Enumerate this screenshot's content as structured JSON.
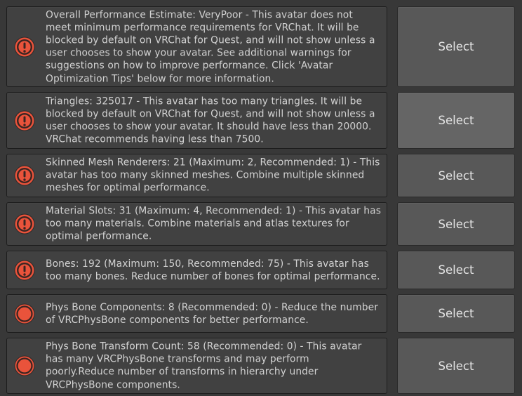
{
  "colors": {
    "background": "#383838",
    "panel": "#414141",
    "button": "#585858",
    "button_hover": "#656565",
    "error_red": "#e9533b",
    "text": "#d2d2d2"
  },
  "items": [
    {
      "icon": "error-exclamation-icon",
      "message": "Overall Performance Estimate: VeryPoor - This avatar does not\nmeet minimum performance requirements for VRChat. It will be\nblocked by default on VRChat for Quest, and will not show unless a\nuser chooses to show your avatar. See additional warnings for\nsuggestions on how to improve performance. Click 'Avatar\nOptimization Tips' below for more information.",
      "button": "Select"
    },
    {
      "icon": "error-exclamation-icon",
      "message": "Triangles: 325017 - This avatar has too many triangles. It will be\nblocked by default on VRChat for Quest, and will not show unless a\nuser chooses to show your avatar. It should have less than 20000.\nVRChat recommends having less than 7500.",
      "button": "Select"
    },
    {
      "icon": "error-exclamation-icon",
      "message": "Skinned Mesh Renderers: 21 (Maximum: 2, Recommended: 1) - This\navatar has too many skinned meshes. Combine multiple skinned\nmeshes for optimal performance.",
      "button": "Select"
    },
    {
      "icon": "error-exclamation-icon",
      "message": "Material Slots: 31 (Maximum: 4, Recommended: 1) - This avatar has\ntoo many materials. Combine materials and atlas textures for\noptimal performance.",
      "button": "Select"
    },
    {
      "icon": "error-exclamation-icon",
      "message": "Bones: 192 (Maximum: 150, Recommended: 75) - This avatar has\ntoo many bones. Reduce number of bones for optimal performance.",
      "button": "Select"
    },
    {
      "icon": "warning-dot-icon",
      "message": "Phys Bone Components: 8 (Recommended: 0) - Reduce the number\nof VRCPhysBone components for better performance.",
      "button": "Select"
    },
    {
      "icon": "warning-dot-icon",
      "message": "Phys Bone Transform Count: 58 (Recommended: 0) - This avatar\nhas many VRCPhysBone transforms and may perform\npoorly.Reduce number of transforms in hierarchy under\nVRCPhysBone components.",
      "button": "Select"
    }
  ]
}
